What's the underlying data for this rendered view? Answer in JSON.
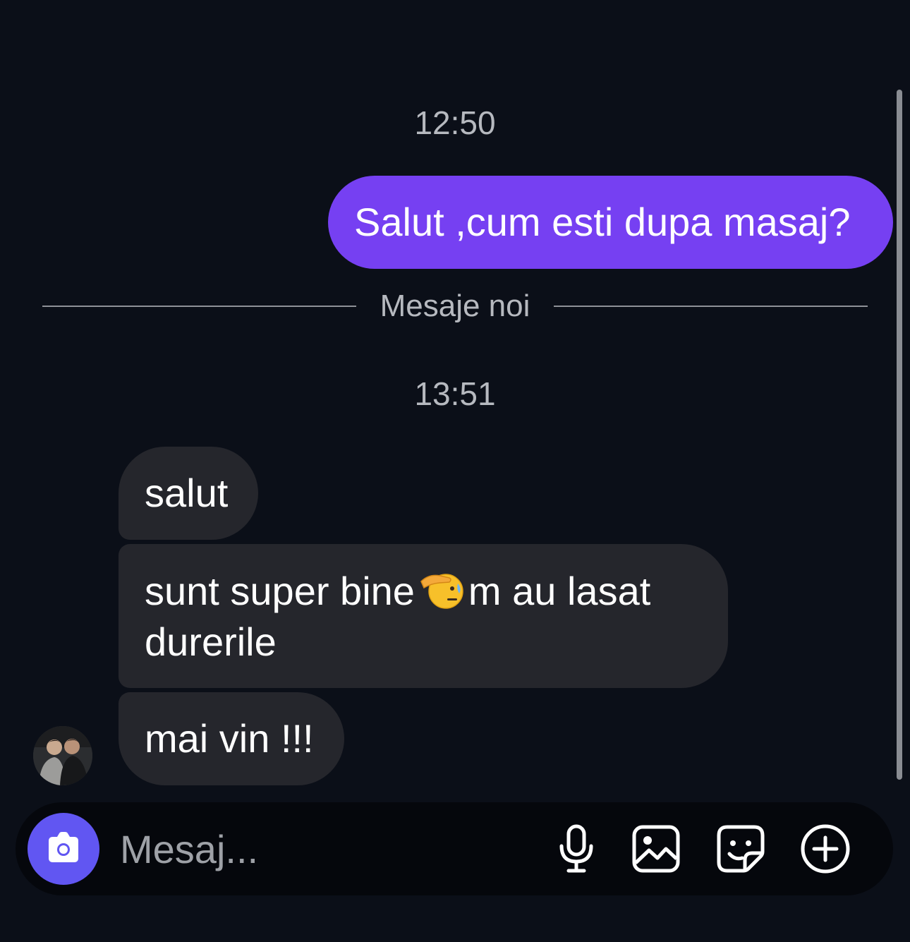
{
  "conversation": {
    "timestamp_1": "12:50",
    "outgoing_message": "Salut ,cum esti dupa masaj?",
    "divider_label": "Mesaje noi",
    "timestamp_2": "13:51",
    "incoming": {
      "msg_1": "salut",
      "msg_2_part_1": "sunt super bine",
      "msg_2_emoji": "saluting-face-emoji",
      "msg_2_part_2": "m au lasat durerile",
      "msg_3": "mai vin !!!"
    }
  },
  "composer": {
    "placeholder": "Mesaj...",
    "camera_icon": "camera-icon",
    "mic_icon": "microphone-icon",
    "gallery_icon": "image-icon",
    "sticker_icon": "sticker-icon",
    "plus_icon": "plus-circle-icon"
  },
  "colors": {
    "background": "#0b0f18",
    "outgoing_bubble": "#7640f2",
    "incoming_bubble": "#25262c",
    "camera_button": "#6156f2"
  }
}
